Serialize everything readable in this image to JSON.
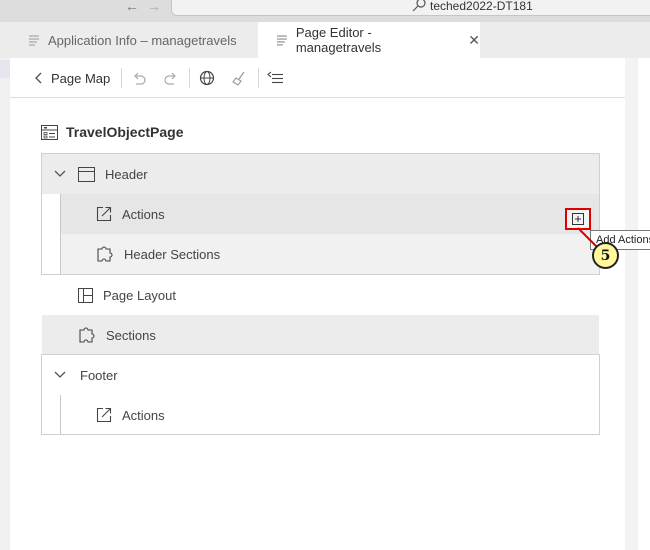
{
  "browser": {
    "back_arrow": "←",
    "forward_arrow": "→",
    "address_text": "teched2022-DT181"
  },
  "tabs": [
    {
      "label": "Application Info – managetravels",
      "active": false
    },
    {
      "label": "Page Editor - managetravels",
      "active": true,
      "close": "✕"
    }
  ],
  "toolbar": {
    "page_map_label": "Page Map"
  },
  "page": {
    "title": "TravelObjectPage"
  },
  "tree": {
    "header": {
      "label": "Header",
      "expanded": true
    },
    "header_actions": {
      "label": "Actions"
    },
    "header_sections": {
      "label": "Header Sections"
    },
    "page_layout": {
      "label": "Page Layout"
    },
    "sections": {
      "label": "Sections"
    },
    "footer": {
      "label": "Footer",
      "expanded": true
    },
    "footer_actions": {
      "label": "Actions"
    }
  },
  "tooltip": {
    "text": "Add Actions"
  },
  "callout": {
    "number": "5"
  },
  "colors": {
    "highlight": "#e00000",
    "callout_fill": "#fff799",
    "row_gray": "#ececec"
  }
}
